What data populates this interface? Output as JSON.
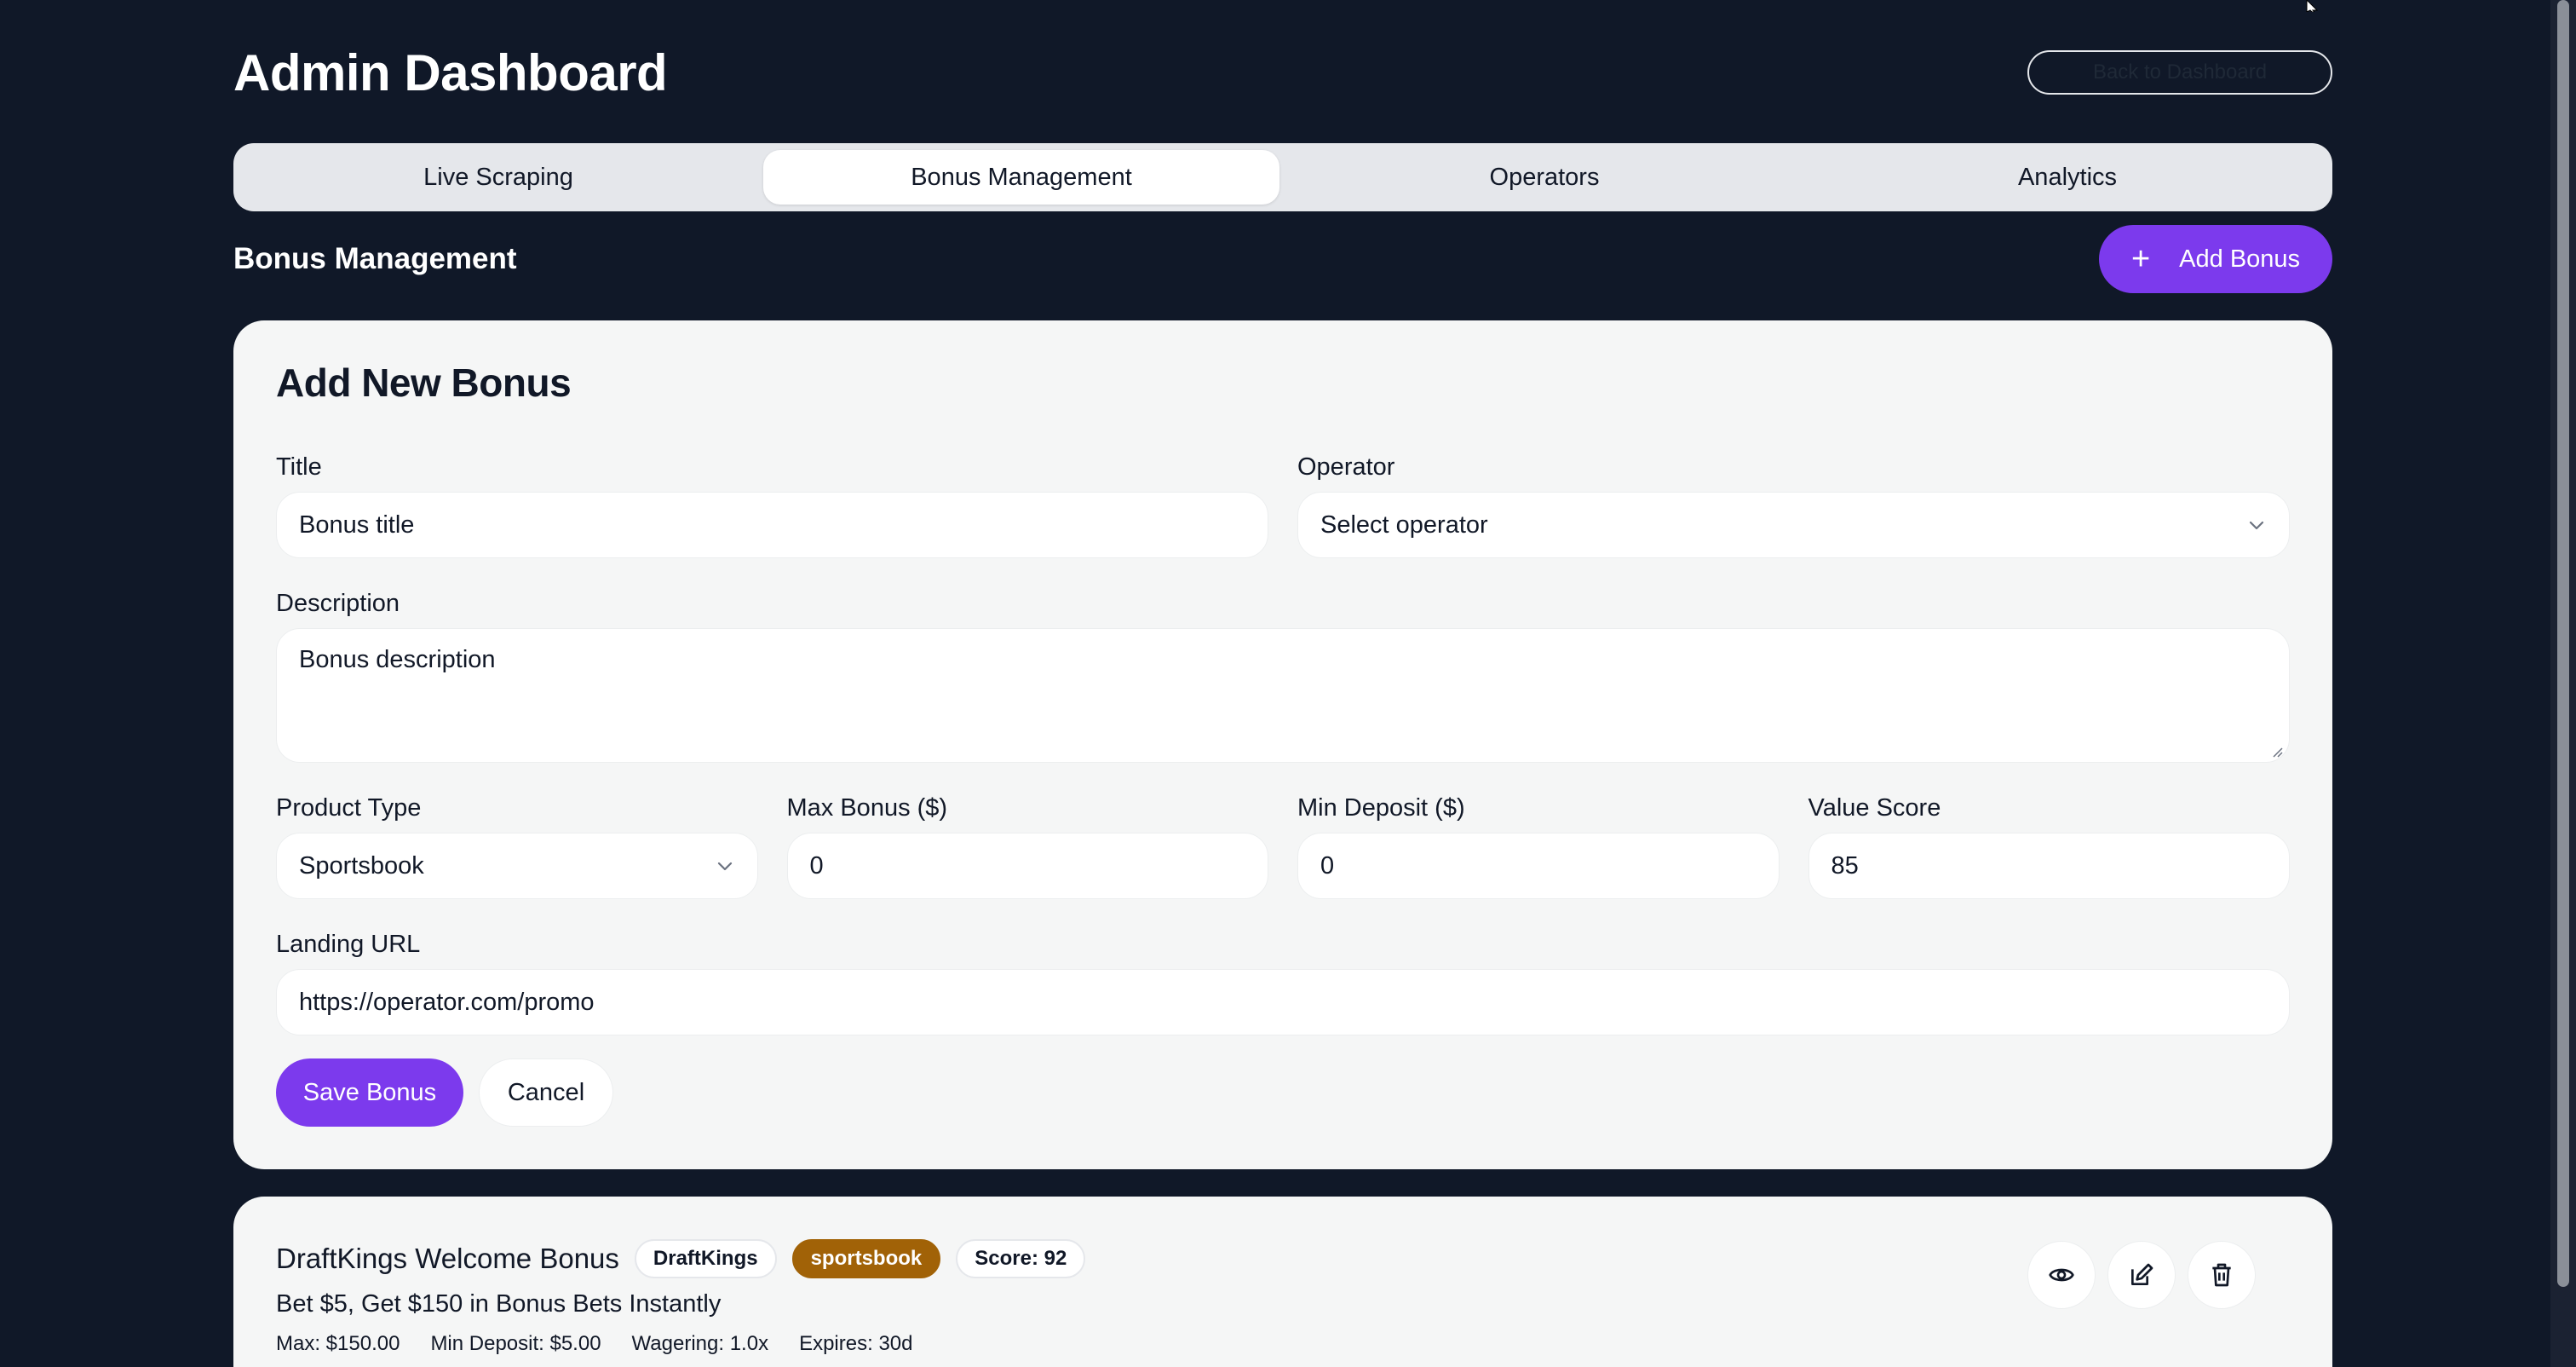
{
  "header": {
    "title": "Admin Dashboard",
    "right_button_label": "Back to Dashboard"
  },
  "tabs": [
    {
      "label": "Live Scraping",
      "active": false
    },
    {
      "label": "Bonus Management",
      "active": true
    },
    {
      "label": "Operators",
      "active": false
    },
    {
      "label": "Analytics",
      "active": false
    }
  ],
  "section": {
    "title": "Bonus Management",
    "add_button_label": "Add Bonus",
    "add_button_icon": "plus-icon"
  },
  "form": {
    "heading": "Add New Bonus",
    "title": {
      "label": "Title",
      "placeholder": "Bonus title"
    },
    "operator": {
      "label": "Operator",
      "value": "Select operator"
    },
    "description": {
      "label": "Description",
      "placeholder": "Bonus description"
    },
    "product_type": {
      "label": "Product Type",
      "value": "Sportsbook"
    },
    "max_bonus": {
      "label": "Max Bonus ($)",
      "value": "0"
    },
    "min_deposit": {
      "label": "Min Deposit ($)",
      "value": "0"
    },
    "value_score": {
      "label": "Value Score",
      "value": "85"
    },
    "landing_url": {
      "label": "Landing URL",
      "placeholder": "https://operator.com/promo"
    },
    "save_label": "Save Bonus",
    "cancel_label": "Cancel"
  },
  "bonus_list": [
    {
      "title": "DraftKings Welcome Bonus",
      "operator": "DraftKings",
      "product": "sportsbook",
      "score": "Score: 92",
      "description": "Bet $5, Get $150 in Bonus Bets Instantly",
      "max": "Max: $150.00",
      "min_deposit": "Min Deposit: $5.00",
      "wagering": "Wagering: 1.0x",
      "expires": "Expires: 30d"
    }
  ],
  "colors": {
    "background": "#101828",
    "accent": "#7c3aed",
    "card": "#f5f6f6",
    "product_badge": "#a16207"
  }
}
